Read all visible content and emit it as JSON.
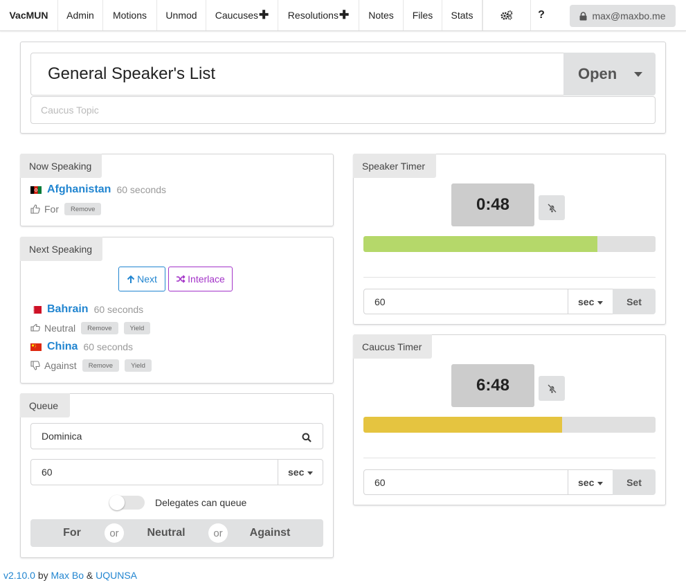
{
  "nav": {
    "brand": "VacMUN",
    "items": [
      "Admin",
      "Motions",
      "Unmod",
      "Caucuses",
      "Resolutions",
      "Notes",
      "Files",
      "Stats"
    ],
    "plus_glyph": "✚",
    "help_label": "?",
    "user_email": "max@maxbo.me"
  },
  "caucus": {
    "title": "General Speaker's List",
    "status": "Open",
    "topic_placeholder": "Caucus Topic"
  },
  "now_speaking": {
    "label": "Now Speaking",
    "country": "Afghanistan",
    "duration": "60 seconds",
    "stance": "For",
    "remove_label": "Remove"
  },
  "next_speaking": {
    "label": "Next Speaking",
    "next_label": "Next",
    "interlace_label": "Interlace",
    "speakers": [
      {
        "country": "Bahrain",
        "duration": "60 seconds",
        "stance": "Neutral",
        "remove_label": "Remove",
        "yield_label": "Yield"
      },
      {
        "country": "China",
        "duration": "60 seconds",
        "stance": "Against",
        "remove_label": "Remove",
        "yield_label": "Yield"
      }
    ]
  },
  "queue": {
    "label": "Queue",
    "country_value": "Dominica",
    "duration_value": "60",
    "unit": "sec",
    "toggle_label": "Delegates can queue",
    "toggle_on": false,
    "stances": [
      "For",
      "Neutral",
      "Against"
    ],
    "or_label": "or"
  },
  "speaker_timer": {
    "label": "Speaker Timer",
    "time": "0:48",
    "progress_fraction": 0.8,
    "bar_color": "#b5d86a",
    "input_value": "60",
    "unit": "sec",
    "set_label": "Set"
  },
  "caucus_timer": {
    "label": "Caucus Timer",
    "time": "6:48",
    "progress_fraction": 0.68,
    "bar_color": "#e5c440",
    "input_value": "60",
    "unit": "sec",
    "set_label": "Set"
  },
  "footer": {
    "version": "v2.10.0",
    "by": "by",
    "author": "Max Bo",
    "amp": "&",
    "org": "UQUNSA"
  }
}
